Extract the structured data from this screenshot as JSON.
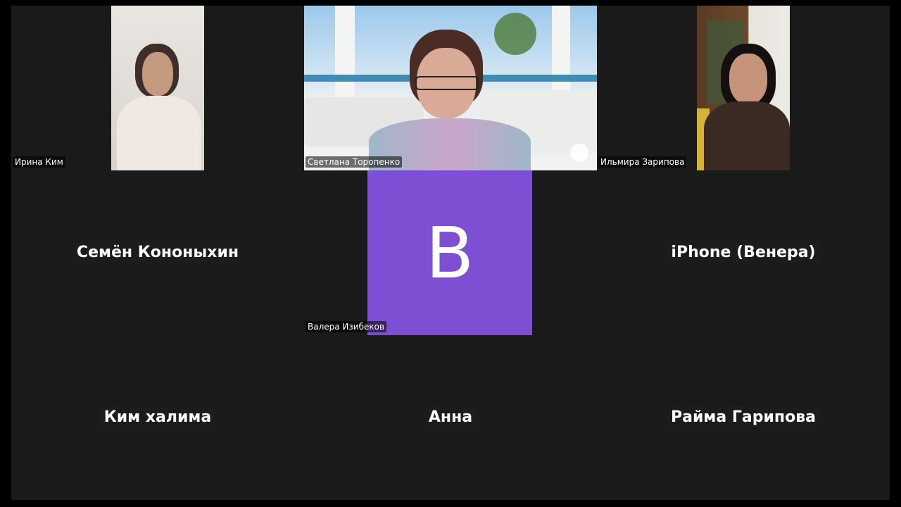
{
  "participants": [
    {
      "name": "Ирина  Ким",
      "video": true
    },
    {
      "name": "Светлана Торопенко",
      "video": true,
      "active_speaker": true
    },
    {
      "name": "Ильмира Зарипова",
      "video": true
    },
    {
      "name": "Семён Кононыхин",
      "video": false
    },
    {
      "name": "Валера Изибеков",
      "video": false,
      "avatar_letter": "B",
      "avatar_color": "#7e4fd3"
    },
    {
      "name": "iPhone (Венера)",
      "video": false
    },
    {
      "name": "Ким халима",
      "video": false
    },
    {
      "name": "Анна",
      "video": false
    },
    {
      "name": "Райма Гарипова",
      "video": false
    }
  ],
  "colors": {
    "background": "#1a1a1a",
    "letterbox": "#000000",
    "avatar": "#7e4fd3"
  }
}
